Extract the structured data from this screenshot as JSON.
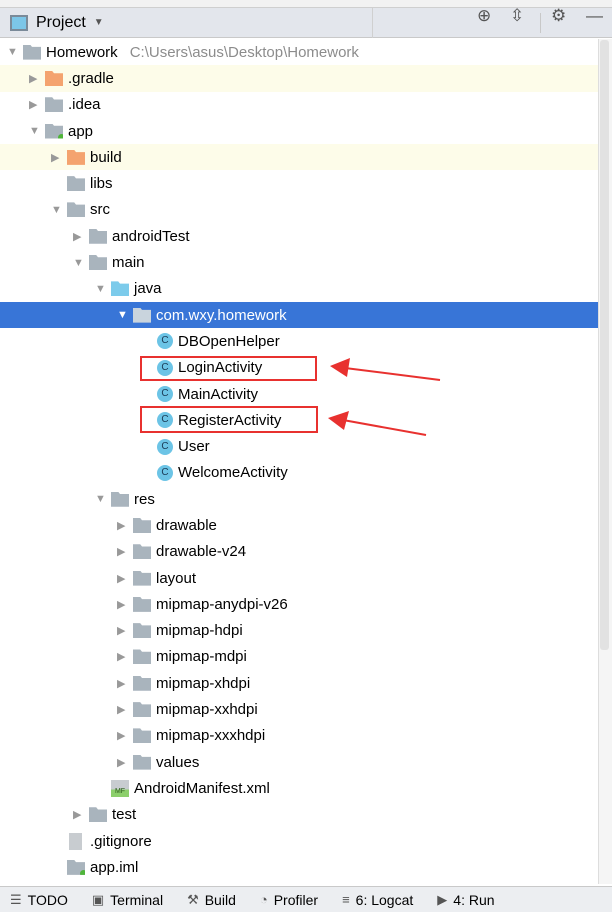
{
  "header": {
    "title": "Project"
  },
  "tree": [
    {
      "label": "Homework",
      "path": "C:\\Users\\asus\\Desktop\\Homework",
      "level": 0,
      "arrow": "down",
      "icon": "module"
    },
    {
      "label": ".gradle",
      "level": 1,
      "arrow": "right",
      "icon": "folder-orange",
      "highlight": true
    },
    {
      "label": ".idea",
      "level": 1,
      "arrow": "right",
      "icon": "folder"
    },
    {
      "label": "app",
      "level": 1,
      "arrow": "down",
      "icon": "module-app"
    },
    {
      "label": "build",
      "level": 2,
      "arrow": "right",
      "icon": "folder-orange",
      "highlight": true
    },
    {
      "label": "libs",
      "level": 2,
      "arrow": "",
      "icon": "folder"
    },
    {
      "label": "src",
      "level": 2,
      "arrow": "down",
      "icon": "folder"
    },
    {
      "label": "androidTest",
      "level": 3,
      "arrow": "right",
      "icon": "folder"
    },
    {
      "label": "main",
      "level": 3,
      "arrow": "down",
      "icon": "folder"
    },
    {
      "label": "java",
      "level": 4,
      "arrow": "down",
      "icon": "folder-blue"
    },
    {
      "label": "com.wxy.homework",
      "level": 5,
      "arrow": "down",
      "icon": "package",
      "selected": true
    },
    {
      "label": "DBOpenHelper",
      "level": 6,
      "arrow": "",
      "icon": "class"
    },
    {
      "label": "LoginActivity",
      "level": 6,
      "arrow": "",
      "icon": "class",
      "boxed": true
    },
    {
      "label": "MainActivity",
      "level": 6,
      "arrow": "",
      "icon": "class"
    },
    {
      "label": "RegisterActivity",
      "level": 6,
      "arrow": "",
      "icon": "class",
      "boxed": true
    },
    {
      "label": "User",
      "level": 6,
      "arrow": "",
      "icon": "class"
    },
    {
      "label": "WelcomeActivity",
      "level": 6,
      "arrow": "",
      "icon": "class"
    },
    {
      "label": "res",
      "level": 4,
      "arrow": "down",
      "icon": "folder-res"
    },
    {
      "label": "drawable",
      "level": 5,
      "arrow": "right",
      "icon": "package"
    },
    {
      "label": "drawable-v24",
      "level": 5,
      "arrow": "right",
      "icon": "package"
    },
    {
      "label": "layout",
      "level": 5,
      "arrow": "right",
      "icon": "package"
    },
    {
      "label": "mipmap-anydpi-v26",
      "level": 5,
      "arrow": "right",
      "icon": "package"
    },
    {
      "label": "mipmap-hdpi",
      "level": 5,
      "arrow": "right",
      "icon": "package"
    },
    {
      "label": "mipmap-mdpi",
      "level": 5,
      "arrow": "right",
      "icon": "package"
    },
    {
      "label": "mipmap-xhdpi",
      "level": 5,
      "arrow": "right",
      "icon": "package"
    },
    {
      "label": "mipmap-xxhdpi",
      "level": 5,
      "arrow": "right",
      "icon": "package"
    },
    {
      "label": "mipmap-xxxhdpi",
      "level": 5,
      "arrow": "right",
      "icon": "package"
    },
    {
      "label": "values",
      "level": 5,
      "arrow": "right",
      "icon": "package"
    },
    {
      "label": "AndroidManifest.xml",
      "level": 4,
      "arrow": "",
      "icon": "manifest"
    },
    {
      "label": "test",
      "level": 3,
      "arrow": "right",
      "icon": "folder"
    },
    {
      "label": ".gitignore",
      "level": 2,
      "arrow": "",
      "icon": "file"
    },
    {
      "label": "app.iml",
      "level": 2,
      "arrow": "",
      "icon": "module-app"
    }
  ],
  "bottom_tabs": [
    {
      "label": "TODO",
      "icon": "list-icon"
    },
    {
      "label": "Terminal",
      "icon": "terminal-icon"
    },
    {
      "label": "Build",
      "icon": "hammer-icon"
    },
    {
      "label": "Profiler",
      "icon": "gauge-icon"
    },
    {
      "label": "6: Logcat",
      "icon": "logcat-icon"
    },
    {
      "label": "4: Run",
      "icon": "run-icon"
    }
  ],
  "colors": {
    "selection": "#3875d7",
    "annotation": "#e8312f"
  }
}
